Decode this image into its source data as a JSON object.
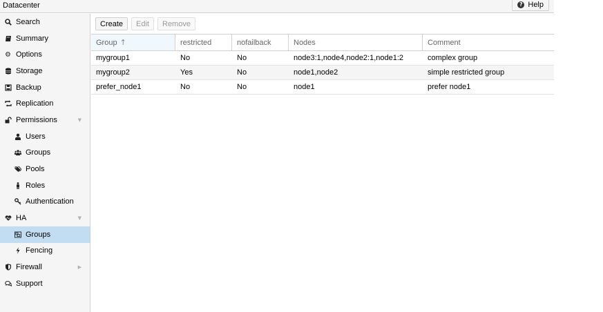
{
  "header": {
    "title": "Datacenter",
    "help_label": "Help"
  },
  "sidebar": {
    "items": [
      {
        "label": "Search",
        "icon": "search-icon"
      },
      {
        "label": "Summary",
        "icon": "book-icon"
      },
      {
        "label": "Options",
        "icon": "gear-icon"
      },
      {
        "label": "Storage",
        "icon": "database-icon"
      },
      {
        "label": "Backup",
        "icon": "floppy-icon"
      },
      {
        "label": "Replication",
        "icon": "retweet-icon"
      },
      {
        "label": "Permissions",
        "icon": "unlock-icon"
      },
      {
        "label": "Users",
        "icon": "user-icon"
      },
      {
        "label": "Groups",
        "icon": "users-icon"
      },
      {
        "label": "Pools",
        "icon": "tags-icon"
      },
      {
        "label": "Roles",
        "icon": "male-icon"
      },
      {
        "label": "Authentication",
        "icon": "key-icon"
      },
      {
        "label": "HA",
        "icon": "heartbeat-icon"
      },
      {
        "label": "Groups",
        "icon": "object-group-icon"
      },
      {
        "label": "Fencing",
        "icon": "bolt-icon"
      },
      {
        "label": "Firewall",
        "icon": "shield-icon"
      },
      {
        "label": "Support",
        "icon": "comments-icon"
      }
    ]
  },
  "toolbar": {
    "create_label": "Create",
    "edit_label": "Edit",
    "remove_label": "Remove"
  },
  "grid": {
    "columns": [
      "Group",
      "restricted",
      "nofailback",
      "Nodes",
      "Comment"
    ],
    "rows": [
      [
        "mygroup1",
        "No",
        "No",
        "node3:1,node4,node2:1,node1:2",
        "complex group"
      ],
      [
        "mygroup2",
        "Yes",
        "No",
        "node1,node2",
        "simple restricted group"
      ],
      [
        "prefer_node1",
        "No",
        "No",
        "node1",
        "prefer node1"
      ]
    ]
  },
  "colors": {
    "active_row": "#c2ddf2",
    "sorted_header": "#f0f7fd",
    "sidebar_bg": "#f5f5f5"
  }
}
